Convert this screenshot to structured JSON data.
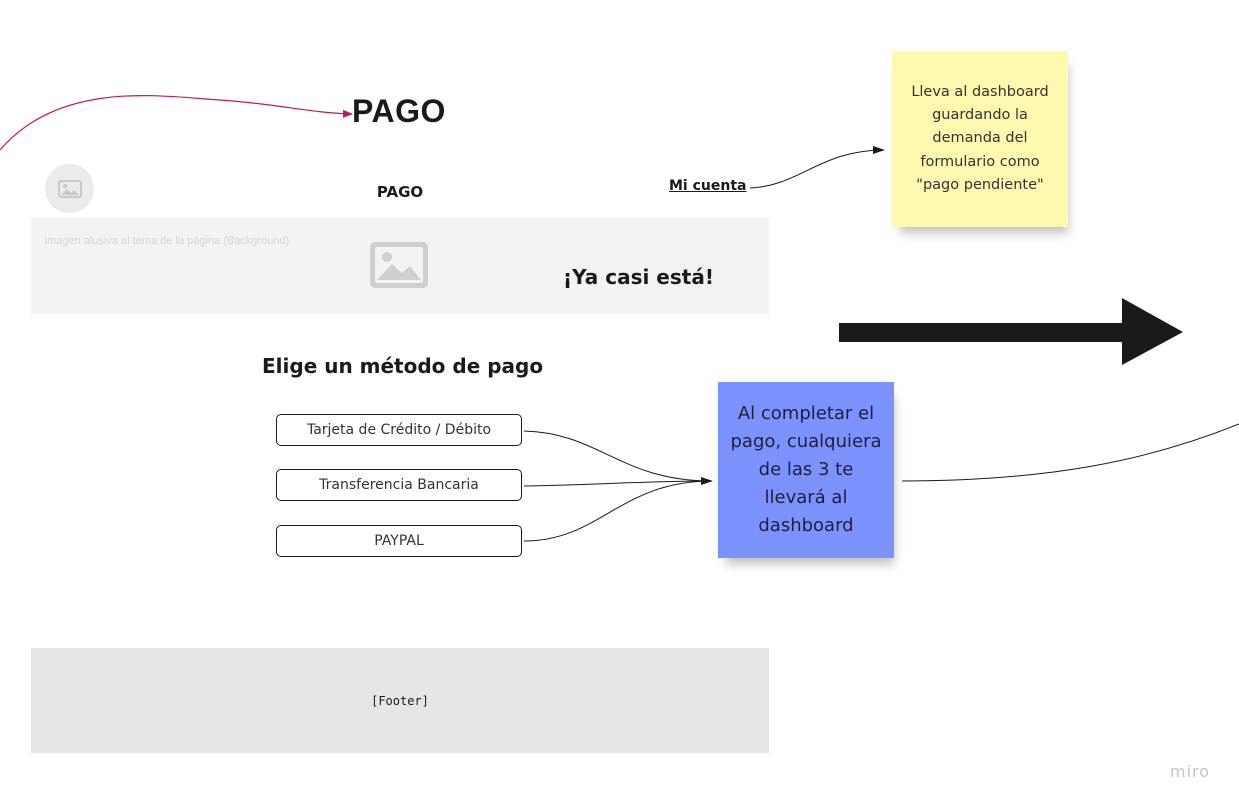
{
  "board": {
    "title": "PAGO",
    "watermark": "miro"
  },
  "wireframe": {
    "header": {
      "logo_icon": "image-placeholder-icon",
      "title": "PAGO",
      "account_link": "Mi cuenta"
    },
    "hero": {
      "caption": "Imagen alusiva al tema de la página (Background)",
      "image_icon": "image-placeholder-icon",
      "heading": "¡Ya casi está!"
    },
    "payment": {
      "heading": "Elige un método de pago",
      "methods": [
        {
          "label": "Tarjeta de Crédito / Débito"
        },
        {
          "label": "Transferencia Bancaria"
        },
        {
          "label": "PAYPAL"
        }
      ]
    },
    "footer": {
      "label": "[Footer]"
    }
  },
  "notes": {
    "yellow": {
      "text": "Lleva al dashboard guardando la demanda del formulario como \"pago pendiente\"",
      "color": "#fff9b0"
    },
    "blue": {
      "text": "Al completar el pago, cualquiera de las 3 te llevará al dashboard",
      "color": "#7b92ff"
    }
  },
  "colors": {
    "incoming_connector": "#c2185b",
    "big_arrow": "#1a1a1a",
    "connector": "#1a1a1a"
  }
}
